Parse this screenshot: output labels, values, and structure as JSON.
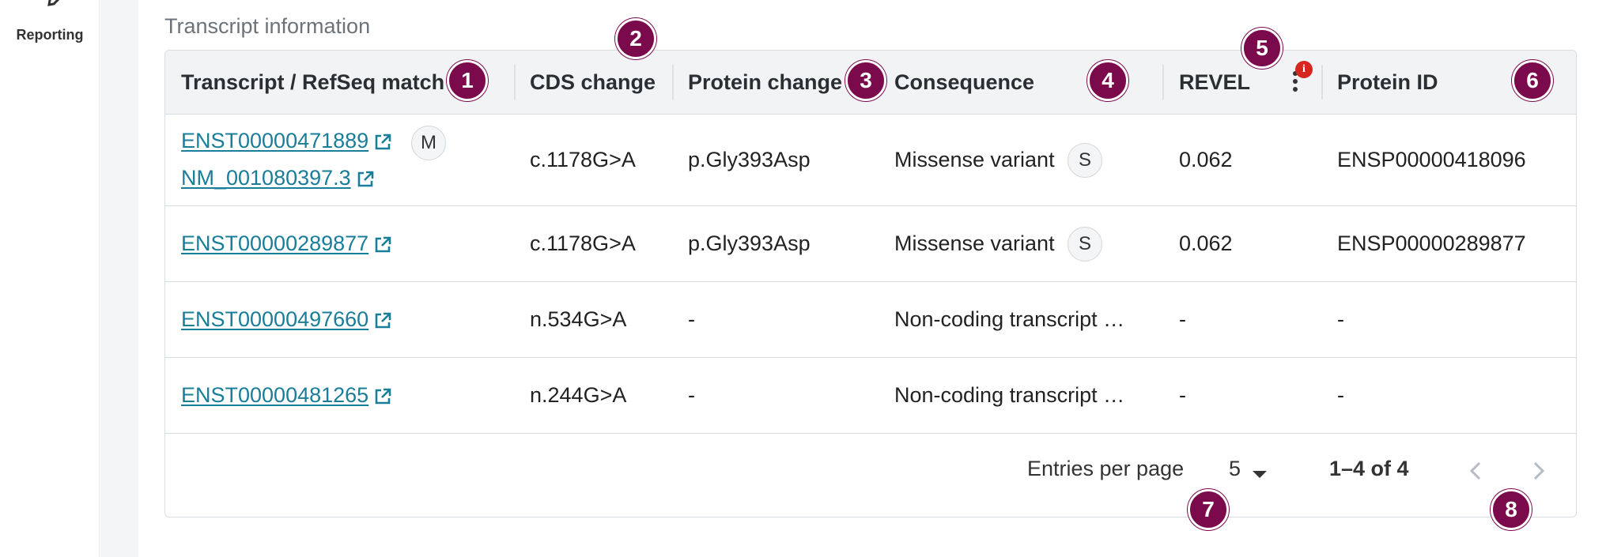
{
  "sidebar": {
    "reporting_label": "Reporting"
  },
  "section": {
    "title": "Transcript information"
  },
  "table": {
    "headers": {
      "transcript": "Transcript / RefSeq match",
      "cds": "CDS change",
      "protein_change": "Protein change",
      "consequence": "Consequence",
      "revel": "REVEL",
      "protein_id": "Protein ID"
    },
    "revel_info_badge": "i",
    "rows": [
      {
        "transcript": "ENST00000471889",
        "badge": "M",
        "refseq": "NM_001080397.3",
        "cds": "c.1178G>A",
        "protein_change": "p.Gly393Asp",
        "consequence": "Missense variant",
        "consequence_badge": "S",
        "revel": "0.062",
        "protein_id": "ENSP00000418096"
      },
      {
        "transcript": "ENST00000289877",
        "cds": "c.1178G>A",
        "protein_change": "p.Gly393Asp",
        "consequence": "Missense variant",
        "consequence_badge": "S",
        "revel": "0.062",
        "protein_id": "ENSP00000289877"
      },
      {
        "transcript": "ENST00000497660",
        "cds": "n.534G>A",
        "protein_change": "-",
        "consequence": "Non-coding transcript …",
        "revel": "-",
        "protein_id": "-"
      },
      {
        "transcript": "ENST00000481265",
        "cds": "n.244G>A",
        "protein_change": "-",
        "consequence": "Non-coding transcript …",
        "revel": "-",
        "protein_id": "-"
      }
    ]
  },
  "pagination": {
    "entries_label": "Entries per page",
    "per_page": "5",
    "range": "1–4 of 4"
  },
  "callouts": [
    "1",
    "2",
    "3",
    "4",
    "5",
    "6",
    "7",
    "8"
  ],
  "colors": {
    "callout": "#7a0a4c",
    "link": "#1a7d99",
    "header_bg": "#f1f3f5",
    "info_badge": "#d7261e"
  }
}
